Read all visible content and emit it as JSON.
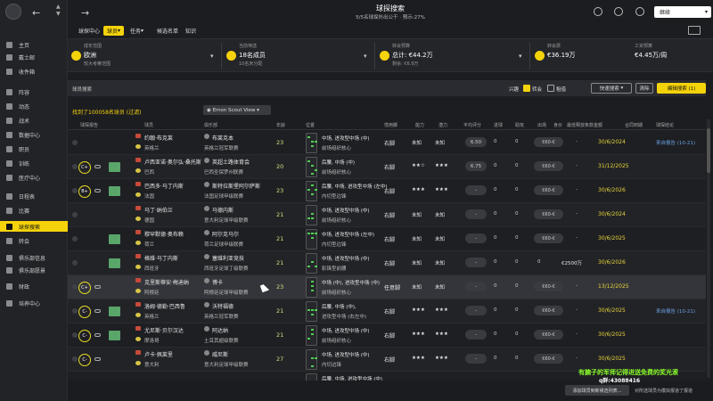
{
  "sidebar": {
    "items": [
      {
        "label": "主页"
      },
      {
        "label": "戴士邮"
      },
      {
        "label": "收件箱"
      },
      {
        "label": "阵容"
      },
      {
        "label": "动态"
      },
      {
        "label": "战术"
      },
      {
        "label": "数据中心"
      },
      {
        "label": "职员"
      },
      {
        "label": "训练"
      },
      {
        "label": "医疗中心"
      },
      {
        "label": "日程表"
      },
      {
        "label": "比赛"
      },
      {
        "label": "球探搜索"
      },
      {
        "label": "转会"
      },
      {
        "label": "俱乐部信息"
      },
      {
        "label": "俱乐部愿景"
      },
      {
        "label": "财政"
      },
      {
        "label": "培养中心"
      }
    ]
  },
  "header": {
    "title": "球探搜索",
    "subtitle": "5/5名球探外出公干 · 预示:27%",
    "continue_label": "继续"
  },
  "tabs": [
    {
      "label": "球探中心"
    },
    {
      "label": "球员"
    },
    {
      "label": "任务"
    },
    {
      "label": "候选名单"
    },
    {
      "label": "知识"
    }
  ],
  "filters": [
    {
      "label": "成年范围",
      "value": "欧洲",
      "hint": "较大考察范围"
    },
    {
      "label": "当前筛选",
      "value": "18名成员",
      "hint": "10名未分配"
    },
    {
      "label": "转会预算",
      "value": "总计: €44.2万",
      "hint": "剩余: €6.9万"
    },
    {
      "label": "转会费",
      "value": "€36.19万",
      "hint": ""
    },
    {
      "label": "工资预算",
      "value": "€4.45万/周",
      "hint": ""
    }
  ],
  "controls": {
    "section_label": "球员搜索",
    "interest_label": "兴趣",
    "transfer_label": "转会",
    "loan_label": "租借",
    "quick_search": "快速搜索",
    "clear_label": "清除",
    "edit_search": "编辑搜索 (1)"
  },
  "results": {
    "found_text": "找到了100058名球员 (过滤)",
    "view_label": "Emon Scout View"
  },
  "columns": [
    "球探报告",
    "",
    "",
    "",
    "球员",
    "",
    "俱乐部",
    "年龄",
    "位置",
    "",
    "惯用脚",
    "能力",
    "潜力",
    "平均评分",
    "进球",
    "助攻",
    "出场",
    "身价",
    "最低释放条款金额",
    "合同到期",
    "球探结论"
  ],
  "rows": [
    {
      "scout": "",
      "name": "约翰·布克莱",
      "nation": "英格兰",
      "club": "布莱克本",
      "league": "英格兰冠军联赛",
      "age": "23",
      "pos1": "中场, 进攻型中场 (中)",
      "pos2": "前场组织核心",
      "foot": "右脚",
      "cur": "未知",
      "pot": "未知",
      "avg": "6.50",
      "g": "0",
      "a": "0",
      "apps": "0",
      "price": "€60-€",
      "pct": "-",
      "contract": "30/6/2024",
      "note": "来自报告 (10-21)"
    },
    {
      "scout": "C+",
      "name": "卢西亚诺·奥尔弘·桑托斯",
      "nation": "巴西",
      "club": "英超土路体育会",
      "league": "巴西圣保罗州联赛",
      "age": "20",
      "pos1": "后腰, 中场 (中)",
      "pos2": "前场组织核心",
      "foot": "右脚",
      "cur": "★★☆",
      "pot": "★★★",
      "avg": "6.75",
      "g": "0",
      "a": "0",
      "apps": "0",
      "price": "€60-€",
      "pct": "-",
      "contract": "31/12/2025",
      "note": ""
    },
    {
      "scout": "B+",
      "name": "巴西多·马丁内斯",
      "nation": "法国",
      "club": "斯特拉斯堡阿尔萨斯",
      "league": "法国足球甲级联赛",
      "age": "23",
      "pos1": "后腰, 中场, 进攻型中场 (左中)",
      "pos2": "内切型边锋",
      "foot": "右脚",
      "cur": "★★★",
      "pot": "★★★",
      "avg": "-",
      "g": "0",
      "a": "0",
      "apps": "0",
      "price": "€60-€",
      "pct": "-",
      "contract": "30/6/2026",
      "note": ""
    },
    {
      "scout": "",
      "name": "马丁·纳伯兰",
      "nation": "德国",
      "club": "马德内斯",
      "league": "意大利足球甲级联赛",
      "age": "21",
      "pos1": "中场, 进攻型中场 (中)",
      "pos2": "前场组织核心",
      "foot": "右脚",
      "cur": "未知",
      "pot": "未知",
      "avg": "-",
      "g": "0",
      "a": "0",
      "apps": "0",
      "price": "€60-€",
      "pct": "-",
      "contract": "30/6/2024",
      "note": ""
    },
    {
      "scout": "",
      "name": "穆罕默德·奥布赖",
      "nation": "荷兰",
      "club": "阿尔克马尔",
      "league": "荷兰足球甲级联赛",
      "age": "21",
      "pos1": "中场, 进攻型中场 (左中)",
      "pos2": "内切型边锋",
      "foot": "右脚",
      "cur": "未知",
      "pot": "未知",
      "avg": "-",
      "g": "0",
      "a": "0",
      "apps": "0",
      "price": "€60-€",
      "pct": "-",
      "contract": "30/6/2025",
      "note": ""
    },
    {
      "scout": "",
      "name": "格维·马丁内斯",
      "nation": "西班牙",
      "club": "塞维利亚竞技",
      "league": "西班牙足球丁级联赛",
      "age": "21",
      "pos1": "中场, 进攻型中场 (中)",
      "pos2": "影锋型前腰",
      "foot": "右脚",
      "cur": "未知",
      "pot": "未知",
      "avg": "-",
      "g": "0",
      "a": "0",
      "apps": "0",
      "price": "€2500万",
      "pct": "-",
      "contract": "30/6/2026",
      "note": ""
    },
    {
      "scout": "C+",
      "name": "克里斯蒂安·梅迪纳",
      "nation": "阿根廷",
      "club": "博卡",
      "league": "阿根廷足球甲级联赛",
      "age": "23",
      "pos1": "中场 (中), 进攻型中场 (中)",
      "pos2": "前场组织核心",
      "foot": "任意脚",
      "cur": "未知",
      "pot": "未知",
      "avg": "-",
      "g": "0",
      "a": "0",
      "apps": "0",
      "price": "€60-€",
      "pct": "-",
      "contract": "13/12/2025",
      "note": ""
    },
    {
      "scout": "C-",
      "name": "洛姆·德勒·巴西鲁",
      "nation": "英格兰",
      "club": "沃特福德",
      "league": "英格兰冠军联赛",
      "age": "21",
      "pos1": "后腰, 中场 (中),",
      "pos2": "进攻型中场 (右左中)",
      "foot": "右脚",
      "cur": "★★★",
      "pot": "★★★",
      "avg": "-",
      "g": "0",
      "a": "0",
      "apps": "0",
      "price": "€60-€",
      "pct": "-",
      "contract": "30/6/2025",
      "note": "来自报告 (10-21)"
    },
    {
      "scout": "C-",
      "name": "尤尼斯·贝尔汉达",
      "nation": "摩洛哥",
      "club": "阿达纳",
      "league": "土耳其超级联赛",
      "age": "21",
      "pos1": "中场, 进攻型中场 (中)",
      "pos2": "前场组织核心",
      "foot": "右脚",
      "cur": "★★★",
      "pot": "★★★",
      "avg": "-",
      "g": "0",
      "a": "0",
      "apps": "0",
      "price": "€60-€",
      "pct": "-",
      "contract": "30/6/2025",
      "note": ""
    },
    {
      "scout": "C-",
      "name": "卢卡·佩莱里",
      "nation": "意大利",
      "club": "威尼斯",
      "league": "意大利足球甲级联赛",
      "age": "27",
      "pos1": "中场, 进攻型中场 (中)",
      "pos2": "内切边锋",
      "foot": "右脚",
      "cur": "★★★",
      "pot": "★★★",
      "avg": "-",
      "g": "0",
      "a": "0",
      "apps": "0",
      "price": "€60-€",
      "pct": "-",
      "contract": "30/6/2025",
      "note": ""
    },
    {
      "scout": "",
      "name": "",
      "nation": "",
      "club": "",
      "league": "",
      "age": "",
      "pos1": "后腰, 中场, 进攻型中场 (中)",
      "pos2": "",
      "foot": "",
      "cur": "",
      "pot": "",
      "avg": "",
      "g": "",
      "a": "",
      "apps": "",
      "price": "",
      "pct": "",
      "contract": "",
      "note": ""
    }
  ],
  "bottom": {
    "add_button": "添加球员到新候选列表...",
    "hint": "对所选球员为模拟报道了报道"
  },
  "overlay": {
    "line1": "有腩子的军师记得进送免费的奖光滚",
    "line2": "q群:43088416"
  }
}
